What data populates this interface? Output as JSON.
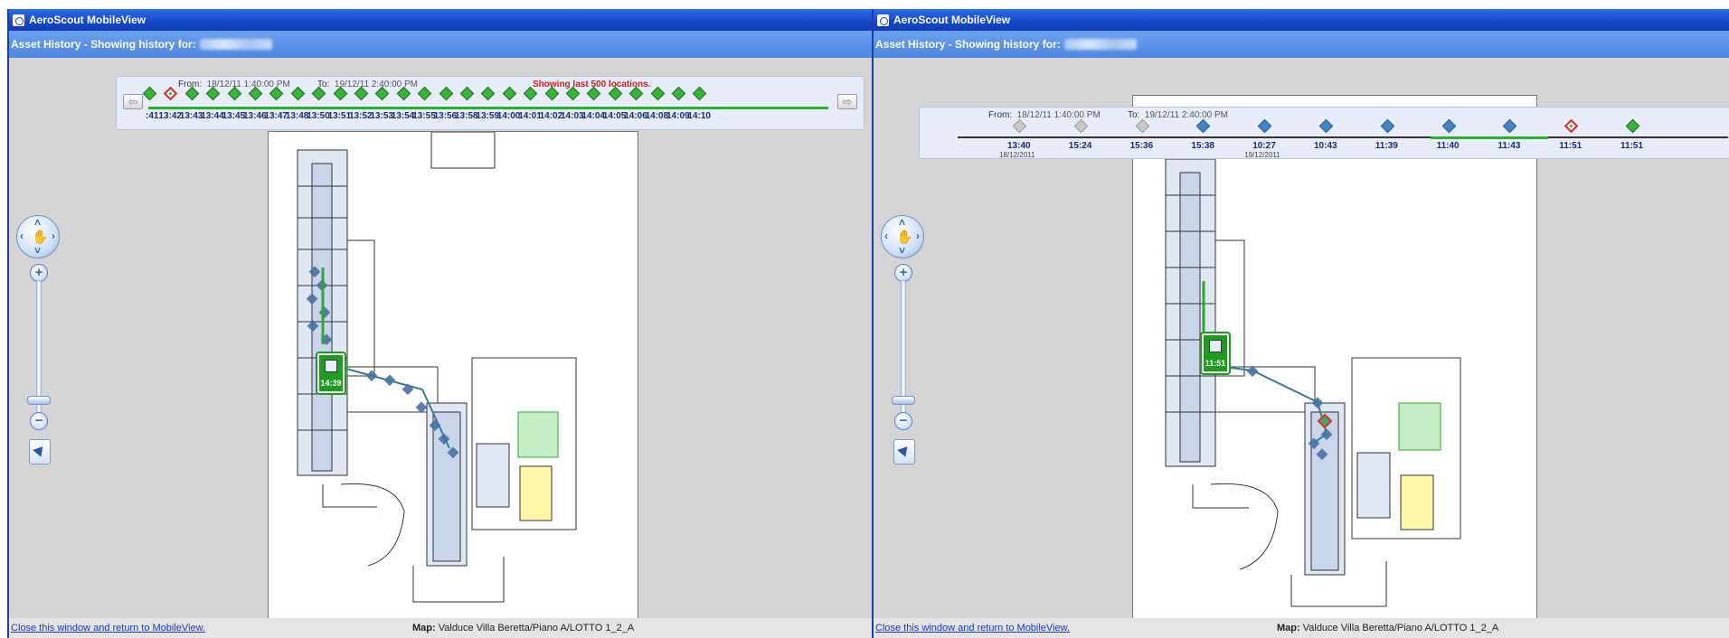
{
  "window_title": "AeroScout MobileView",
  "header_text": "Asset History - Showing history for:",
  "colors": {
    "titlebar": "#1447c8",
    "header": "#5a8fe5",
    "marker_green": "#38b538",
    "warning_red": "#d21c1c",
    "link_blue": "#1b37c9",
    "workspace": "#d4d4d4"
  },
  "left_pane": {
    "from_label": "From:",
    "from_value": "18/12/11 1:40:00 PM",
    "to_label": "To:",
    "to_value": "19/12/11 2:40:00 PM",
    "warning": "Showing last 500 locations.",
    "tick_labels": [
      ":41",
      "13:42",
      "13:43",
      "13:44",
      "13:45",
      "13:46",
      "13:47",
      "13:48",
      "13:50",
      "13:51",
      "13:52",
      "13:53",
      "13:54",
      "13:55",
      "13:56",
      "13:58",
      "13:59",
      "14:00",
      "14:01",
      "14:02",
      "14:03",
      "14:04",
      "14:05",
      "14:06",
      "14:08",
      "14:09",
      "14:10"
    ],
    "current_marker_index": 1,
    "prev_icon": "left-arrow-icon",
    "next_icon": "right-arrow-icon",
    "position_badge_time": "14:39",
    "footer_link": "Close this window and return to MobileView.",
    "map_label": "Map:",
    "map_value": "Valduce Villa Beretta/Piano A/LOTTO 1_2_A"
  },
  "right_pane": {
    "from_label": "From:",
    "from_value": "18/12/11 1:40:00 PM",
    "to_label": "To:",
    "to_value": "19/12/11 2:40:00 PM",
    "tick_labels": [
      "13:40",
      "15:24",
      "15:36",
      "15:38",
      "10:27",
      "10:43",
      "11:39",
      "11:40",
      "11:43",
      "11:51",
      "11:51"
    ],
    "tick_dates": [
      "18/12/2011",
      "",
      "",
      "",
      "19/12/2011",
      "",
      "",
      "",
      "",
      "",
      ""
    ],
    "marker_kinds": [
      "grey",
      "grey",
      "grey",
      "blue",
      "blue",
      "blue",
      "blue",
      "blue",
      "blue",
      "current",
      "green"
    ],
    "position_badge_time": "11:51",
    "footer_link": "Close this window and return to MobileView.",
    "map_label": "Map:",
    "map_value": "Valduce Villa Beretta/Piano A/LOTTO 1_2_A"
  },
  "nav_icons": {
    "pan": "pan-hand-icon",
    "zoom_in": "zoom-in-icon",
    "zoom_out": "zoom-out-icon",
    "select": "select-pointer-icon"
  }
}
